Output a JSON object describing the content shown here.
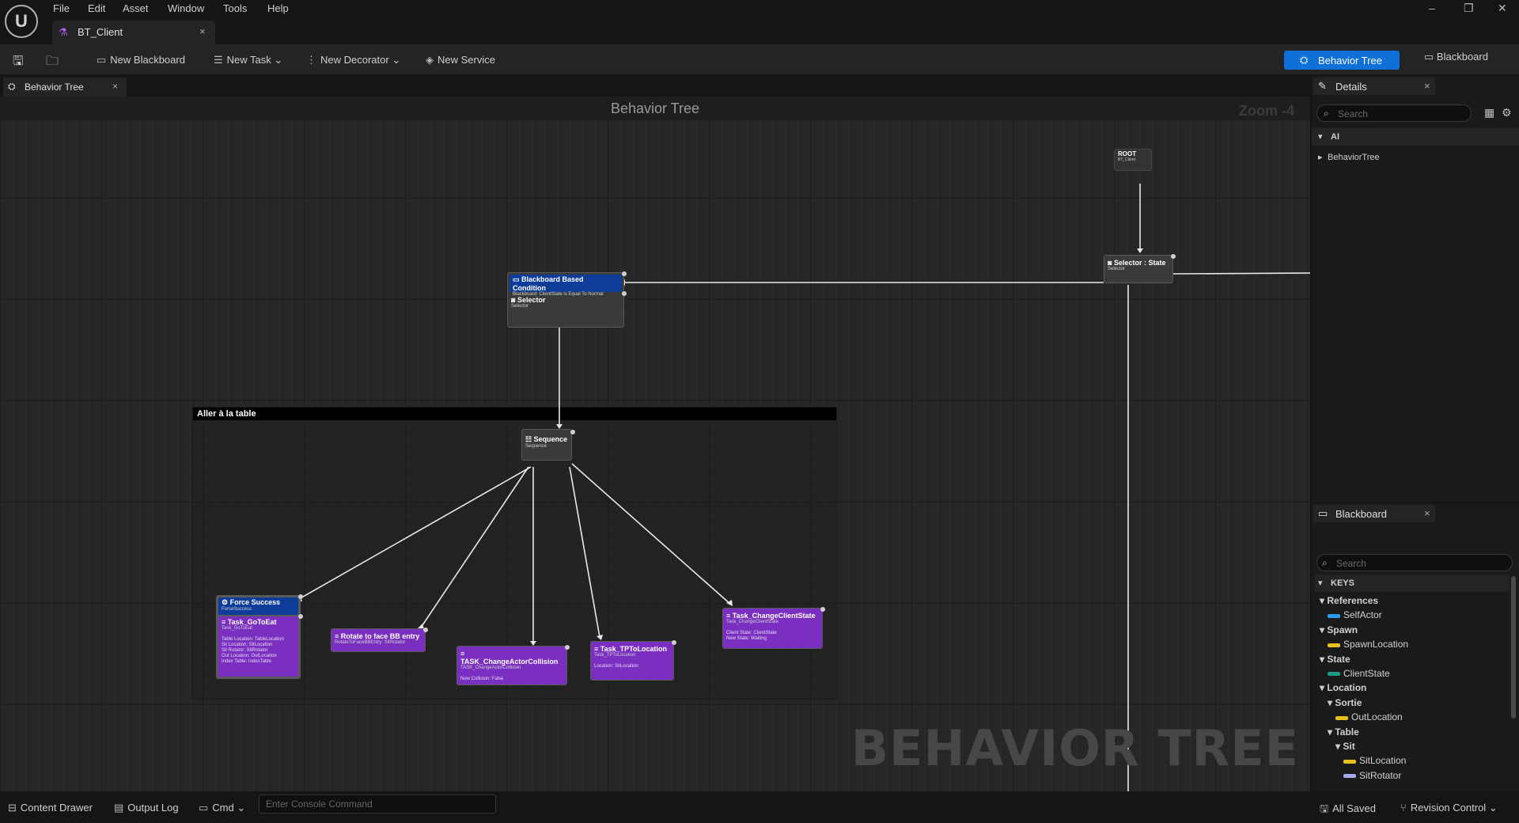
{
  "app": {
    "logo": "unreal-logo",
    "menu": [
      "File",
      "Edit",
      "Asset",
      "Window",
      "Tools",
      "Help"
    ],
    "document_tab": "BT_Client"
  },
  "toolbar": {
    "new_blackboard": "New Blackboard",
    "new_task": "New Task",
    "new_decorator": "New Decorator",
    "new_service": "New Service",
    "mode_behavior_tree": "Behavior Tree",
    "mode_blackboard": "Blackboard"
  },
  "graph": {
    "tab": "Behavior Tree",
    "header": "Behavior Tree",
    "zoom": "Zoom -4",
    "watermark": "BEHAVIOR TREE",
    "comment": "Aller à la table",
    "nodes": {
      "root": {
        "title": "ROOT",
        "sub": "BT_Client"
      },
      "selector_state": {
        "title": "Selector : State",
        "sub": "Selector"
      },
      "bb_condition": {
        "title": "Blackboard Based Condition",
        "sub": "Blackboard: ClientState is Equal To Normal"
      },
      "selector": {
        "title": "Selector",
        "sub": "Selector"
      },
      "sequence": {
        "title": "Sequence",
        "sub": "Sequence"
      },
      "force_success": {
        "title": "Force Success",
        "sub": "ForceSuccess"
      },
      "goto_eat": {
        "title": "Task_GoToEat",
        "sub": "Task_GoToEat",
        "props": [
          "Table Location: TableLocation",
          "Sit Location: SitLocation",
          "Sit Rotator: SitRotator",
          "Out Location: OutLocation",
          "Index Table: IndexTable"
        ]
      },
      "rotate": {
        "title": "Rotate to face BB entry",
        "sub": "RotateToFaceBBEntry: SitRotator"
      },
      "change_collision": {
        "title": "TASK_ChangeActorCollision",
        "sub": "TASK_ChangeActorCollision",
        "props": [
          "New Collision: False"
        ]
      },
      "tp_location": {
        "title": "Task_TPToLocation",
        "sub": "Task_TPToLocation",
        "props": [
          "Location: SitLocation"
        ]
      },
      "change_state": {
        "title": "Task_ChangeClientState",
        "sub": "Task_ChangeClientState",
        "props": [
          "Client State: ClientState",
          "New State: Waiting"
        ]
      }
    }
  },
  "details": {
    "tab": "Details",
    "search_placeholder": "Search",
    "section": "AI",
    "item": "BehaviorTree"
  },
  "blackboard": {
    "tab": "Blackboard",
    "search_placeholder": "Search",
    "keys_header": "KEYS",
    "rows": [
      {
        "label": "References",
        "level": 0,
        "type": "category"
      },
      {
        "label": "SelfActor",
        "level": 1,
        "type": "key",
        "color": "#2b9bf0"
      },
      {
        "label": "Spawn",
        "level": 0,
        "type": "category"
      },
      {
        "label": "SpawnLocation",
        "level": 1,
        "type": "key",
        "color": "#e8c21c"
      },
      {
        "label": "State",
        "level": 0,
        "type": "category"
      },
      {
        "label": "ClientState",
        "level": 1,
        "type": "key",
        "color": "#1a9a86"
      },
      {
        "label": "Location",
        "level": 0,
        "type": "category"
      },
      {
        "label": "Sortie",
        "level": 1,
        "type": "category"
      },
      {
        "label": "OutLocation",
        "level": 2,
        "type": "key",
        "color": "#e8c21c"
      },
      {
        "label": "Table",
        "level": 1,
        "type": "category"
      },
      {
        "label": "Sit",
        "level": 2,
        "type": "category"
      },
      {
        "label": "SitLocation",
        "level": 3,
        "type": "key",
        "color": "#e8c21c"
      },
      {
        "label": "SitRotator",
        "level": 3,
        "type": "key",
        "color": "#a5a9ee"
      }
    ]
  },
  "status": {
    "content_drawer": "Content Drawer",
    "output_log": "Output Log",
    "cmd": "Cmd",
    "console_placeholder": "Enter Console Command",
    "all_saved": "All Saved",
    "revision_control": "Revision Control"
  }
}
